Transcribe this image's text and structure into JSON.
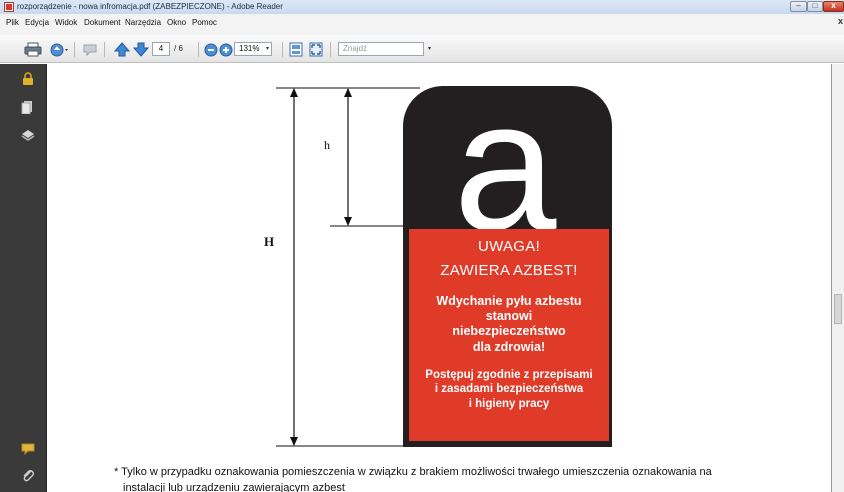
{
  "window": {
    "title": "rozporządzenie - nowa infromacja.pdf (ZABEZPIECZONE) - Adobe Reader",
    "min_symbol": "–",
    "max_symbol": "□",
    "close_symbol": "x",
    "doc_close_symbol": "x"
  },
  "menu": [
    "Plik",
    "Edycja",
    "Widok",
    "Dokument",
    "Narzędzia",
    "Okno",
    "Pomoc"
  ],
  "toolbar": {
    "current_page": "4",
    "page_total": "/ 6",
    "zoom": "131%",
    "find_placeholder": "Znajdź",
    "icons": [
      "print-icon",
      "share-icon",
      "comment-icon",
      "page-up-icon",
      "page-down-icon",
      "zoom-out-icon",
      "zoom-in-icon",
      "fit-page-icon",
      "full-screen-icon"
    ]
  },
  "nav_panel": {
    "icons": [
      "lock-icon",
      "pages-icon",
      "layers-icon",
      "comments-icon",
      "attachments-icon"
    ]
  },
  "document": {
    "dimension_H": "H",
    "dimension_h": "h",
    "label": {
      "letter": "a",
      "title": "UWAGA!",
      "subtitle": "ZAWIERA AZBEST!",
      "warning_lines": [
        "Wdychanie pyłu azbestu",
        "stanowi",
        "niebezpieczeństwo",
        "dla zdrowia!"
      ],
      "advice_lines": [
        "Postępuj zgodnie z przepisami",
        "i zasadami bezpieczeństwa",
        "i higieny pracy"
      ]
    },
    "footnote_line1": "* Tylko w przypadku oznakowania pomieszczenia w związku z brakiem możliwości trwałego umieszczenia oznakowania na",
    "footnote_line2": "instalacji lub urządzeniu zawierającym azbest"
  },
  "colors": {
    "label_black": "#231f20",
    "label_red": "#e03a29",
    "nav_panel": "#3a3a3a"
  }
}
